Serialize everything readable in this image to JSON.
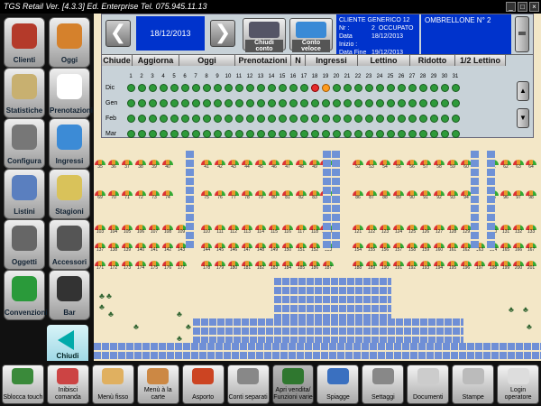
{
  "window": {
    "title": "TGS Retail Ver. [4.3.3] Ed. Enterprise   Tel. 075.945.11.13",
    "min": "_",
    "max": "□",
    "close": "×"
  },
  "sidebar": {
    "items": [
      {
        "label": "Clienti",
        "icon": "clients-icon",
        "color": "#b43a2a"
      },
      {
        "label": "Oggi",
        "icon": "today-icon",
        "color": "#d5812c"
      },
      {
        "label": "Statistiche",
        "icon": "statistics-icon",
        "color": "#c8b070"
      },
      {
        "label": "Prenotazioni",
        "icon": "bookings-icon",
        "color": "#ffffff"
      },
      {
        "label": "Configura",
        "icon": "gear-icon",
        "color": "#777777"
      },
      {
        "label": "Ingressi",
        "icon": "ticket-icon",
        "color": "#3c8bd6"
      },
      {
        "label": "Listini",
        "icon": "price-list-icon",
        "color": "#5a7fbf"
      },
      {
        "label": "Stagioni",
        "icon": "weather-icon",
        "color": "#d9c25a"
      },
      {
        "label": "Oggetti",
        "icon": "objects-icon",
        "color": "#666666"
      },
      {
        "label": "Accessori",
        "icon": "accessories-icon",
        "color": "#555555"
      },
      {
        "label": "Convenzioni",
        "icon": "agreements-icon",
        "color": "#2a9a3a"
      },
      {
        "label": "Bar",
        "icon": "bar-icon",
        "color": "#333333"
      }
    ],
    "close_panel": "Chiudi pannello"
  },
  "panel": {
    "date": "18/12/2013",
    "prev": "❮",
    "next": "❯",
    "btn_close_account": "Chiudi conto",
    "btn_quick_account": "Conto veloce",
    "client": {
      "name": "CLIENTE GENERICO 12",
      "nr_label": "Nr :",
      "nr": "2",
      "status": "OCCUPATO",
      "start_label": "Data Inizio :",
      "start": "18/12/2013",
      "end_label": "Data Fine :",
      "end": "19/12/2013"
    },
    "umbrella": "OMBRELLONE N° 2",
    "tabs": [
      "Chiude",
      "Aggiorna",
      "Oggi",
      "Prenotazioni",
      "N",
      "Ingressi",
      "Lettino",
      "Ridotto",
      "1/2 Lettino"
    ],
    "months": [
      "Dic",
      "Gen",
      "Feb",
      "Mar"
    ],
    "highlight": {
      "red_day": 18,
      "orange_day": 19
    },
    "scroll_up": "▲",
    "scroll_down": "▼"
  },
  "beach": {
    "row1": [
      {
        "g": "a",
        "n": [
          35,
          36,
          37,
          38,
          39,
          40
        ]
      },
      {
        "g": "b",
        "n": [
          41,
          42,
          43,
          44,
          45,
          46,
          47,
          48,
          49,
          50
        ]
      },
      {
        "g": "c",
        "n": [
          51
        ]
      },
      {
        "g": "d",
        "n": [
          52,
          53,
          54,
          55,
          56,
          57,
          58,
          59,
          60
        ]
      },
      {
        "g": "e",
        "n": [
          61,
          62,
          63,
          64
        ]
      }
    ],
    "row2": [
      {
        "g": "a",
        "n": [
          69,
          70,
          71,
          72,
          73,
          74
        ]
      },
      {
        "g": "b",
        "n": [
          75,
          76,
          77,
          78,
          79,
          80,
          81,
          82,
          83,
          84
        ]
      },
      {
        "g": "c",
        "n": [
          85
        ]
      },
      {
        "g": "d",
        "n": [
          86,
          87,
          88,
          89,
          90,
          91,
          92,
          93,
          94
        ]
      },
      {
        "g": "e",
        "n": [
          95,
          96,
          97,
          98
        ]
      }
    ],
    "row3": [
      {
        "g": "a",
        "n": [
          103,
          104,
          105,
          106,
          107,
          108,
          109
        ]
      },
      {
        "g": "b",
        "n": [
          110,
          111,
          112,
          113,
          114,
          115,
          116,
          117,
          118,
          119
        ]
      },
      {
        "g": "c",
        "n": [
          120
        ]
      },
      {
        "g": "d",
        "n": [
          121,
          122,
          123,
          124,
          125,
          126,
          127,
          128,
          129
        ]
      },
      {
        "g": "e",
        "n": [
          130,
          131,
          132,
          133
        ]
      }
    ],
    "row4": [
      {
        "g": "a",
        "n": [
          137,
          138,
          139,
          140,
          141,
          142,
          143
        ]
      },
      {
        "g": "b",
        "n": [
          144,
          145,
          146,
          147,
          148,
          149,
          150,
          151,
          152,
          153
        ]
      },
      {
        "g": "c",
        "n": []
      },
      {
        "g": "d",
        "n": [
          154,
          155,
          156,
          157,
          158,
          159,
          160,
          161,
          162,
          163
        ]
      },
      {
        "g": "e",
        "n": [
          164,
          165,
          166,
          167
        ]
      }
    ],
    "row5": [
      {
        "g": "a",
        "n": [
          171,
          172,
          173,
          174,
          175,
          176,
          177
        ]
      },
      {
        "g": "b",
        "n": [
          178,
          179,
          180,
          181,
          182,
          183,
          184,
          185,
          186,
          187
        ]
      },
      {
        "g": "c",
        "n": []
      },
      {
        "g": "d",
        "n": [
          188,
          189,
          190,
          191,
          192,
          193,
          194,
          195,
          196,
          197
        ]
      },
      {
        "g": "e",
        "n": [
          198,
          199,
          200,
          201
        ]
      }
    ]
  },
  "bottombar": [
    {
      "label": "Sblocca touch",
      "icon": "lock-icon",
      "color": "#3a8a3a",
      "dis": false
    },
    {
      "label": "Inibisci comanda",
      "icon": "printer-icon",
      "color": "#c44",
      "dis": false
    },
    {
      "label": "Menù fisso",
      "icon": "chef-icon",
      "color": "#e0b060",
      "dis": false
    },
    {
      "label": "Menù à la carte",
      "icon": "menu-icon",
      "color": "#cc8844",
      "dis": false
    },
    {
      "label": "Asporto",
      "icon": "delivery-icon",
      "color": "#cc4422",
      "dis": false
    },
    {
      "label": "Conti separati",
      "icon": "split-bill-icon",
      "color": "#888",
      "dis": false
    },
    {
      "label": "Apri vendita/ Funzioni varie",
      "icon": "sale-icon",
      "color": "#3a9a3a",
      "dis": true
    },
    {
      "label": "Spiagge",
      "icon": "beach-icon",
      "color": "#3a70c0",
      "dis": false
    },
    {
      "label": "Settaggi",
      "icon": "settings-icon",
      "color": "#888",
      "dis": false
    },
    {
      "label": "Documenti",
      "icon": "documents-icon",
      "color": "#ccc",
      "dis": false
    },
    {
      "label": "Stampe",
      "icon": "print-icon",
      "color": "#bbb",
      "dis": false
    },
    {
      "label": "Login operatore",
      "icon": "login-icon",
      "color": "#ddd",
      "dis": false
    }
  ]
}
